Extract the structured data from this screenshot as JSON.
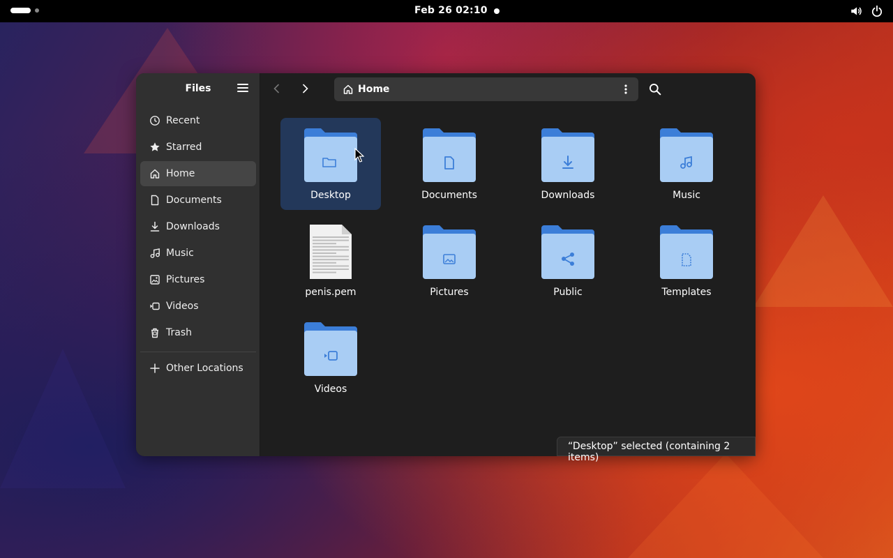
{
  "topbar": {
    "clock": "Feb 26  02:10",
    "icons": [
      "volume-icon",
      "power-icon"
    ]
  },
  "window": {
    "app_title": "Files",
    "sidebar": {
      "items": [
        {
          "label": "Recent",
          "icon": "clock-icon",
          "active": false
        },
        {
          "label": "Starred",
          "icon": "star-icon",
          "active": false
        },
        {
          "label": "Home",
          "icon": "home-icon",
          "active": true
        },
        {
          "label": "Documents",
          "icon": "document-icon",
          "active": false
        },
        {
          "label": "Downloads",
          "icon": "download-icon",
          "active": false
        },
        {
          "label": "Music",
          "icon": "music-icon",
          "active": false
        },
        {
          "label": "Pictures",
          "icon": "picture-icon",
          "active": false
        },
        {
          "label": "Videos",
          "icon": "video-icon",
          "active": false
        },
        {
          "label": "Trash",
          "icon": "trash-icon",
          "active": false
        }
      ],
      "other_locations": "Other Locations"
    },
    "header": {
      "path": "Home"
    },
    "files": [
      {
        "name": "Desktop",
        "type": "folder",
        "emblem": "folder",
        "selected": true
      },
      {
        "name": "Documents",
        "type": "folder",
        "emblem": "document",
        "selected": false
      },
      {
        "name": "Downloads",
        "type": "folder",
        "emblem": "download",
        "selected": false
      },
      {
        "name": "Music",
        "type": "folder",
        "emblem": "music",
        "selected": false
      },
      {
        "name": "penis.pem",
        "type": "text-file",
        "emblem": "text",
        "selected": false
      },
      {
        "name": "Pictures",
        "type": "folder",
        "emblem": "picture",
        "selected": false
      },
      {
        "name": "Public",
        "type": "folder",
        "emblem": "share",
        "selected": false
      },
      {
        "name": "Templates",
        "type": "folder",
        "emblem": "template",
        "selected": false
      },
      {
        "name": "Videos",
        "type": "folder",
        "emblem": "video",
        "selected": false
      }
    ],
    "status": "“Desktop” selected  (containing 2 items)"
  },
  "colors": {
    "folder_dark": "#3c7ed8",
    "folder_light": "#a9cdf4",
    "selection": "#23385a",
    "window_bg": "#1e1e1e",
    "sidebar_bg": "#303030"
  }
}
